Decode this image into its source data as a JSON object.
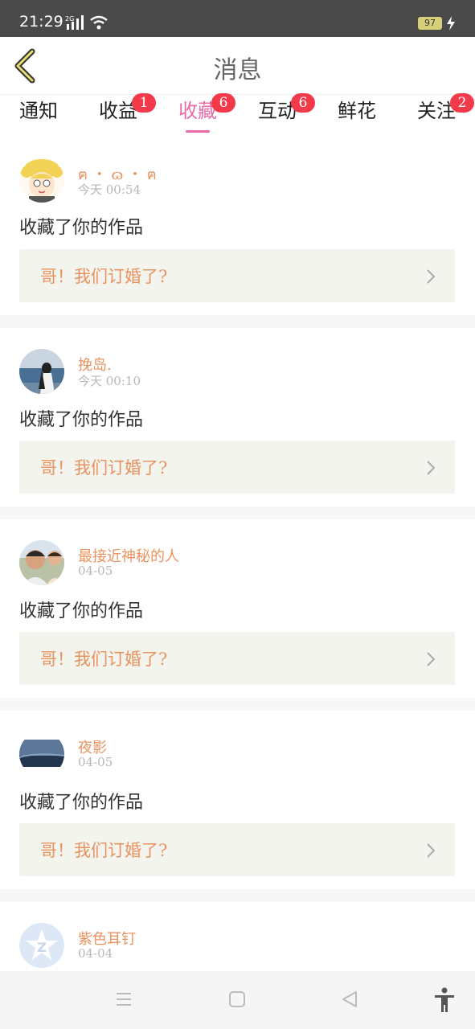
{
  "status": {
    "time": "21:29",
    "network": "2G",
    "battery": "97"
  },
  "header": {
    "title": "消息"
  },
  "tabs": [
    {
      "label": "通知",
      "badge": "",
      "active": false
    },
    {
      "label": "收益",
      "badge": "1",
      "active": false
    },
    {
      "label": "收藏",
      "badge": "6",
      "active": true
    },
    {
      "label": "互动",
      "badge": "6",
      "active": false
    },
    {
      "label": "鲜花",
      "badge": "",
      "active": false
    },
    {
      "label": "关注",
      "badge": "2",
      "active": false
    }
  ],
  "messages": [
    {
      "name": "ฅ ・ ɷ ・ ฅ",
      "time": "今天 00:54",
      "action": "收藏了你的作品",
      "work": "哥！我们订婚了?"
    },
    {
      "name": "挽岛.",
      "time": "今天 00:10",
      "action": "收藏了你的作品",
      "work": "哥！我们订婚了?"
    },
    {
      "name": "最接近神秘的人",
      "time": "04-05",
      "action": "收藏了你的作品",
      "work": "哥！我们订婚了?"
    },
    {
      "name": "夜影",
      "time": "04-05",
      "action": "收藏了你的作品",
      "work": "哥！我们订婚了?"
    },
    {
      "name": "紫色耳钉",
      "time": "04-04",
      "action": "",
      "work": ""
    }
  ],
  "colors": {
    "accent": "#e86aa6",
    "badge": "#f23a4a",
    "username": "#e8935f",
    "card_bg": "#f4f4ee"
  },
  "icons": {
    "back": "chevron-left-icon",
    "arrow": "chevron-right-icon",
    "nav": [
      "menu-icon",
      "home-square-icon",
      "back-triangle-icon",
      "accessibility-icon"
    ]
  }
}
